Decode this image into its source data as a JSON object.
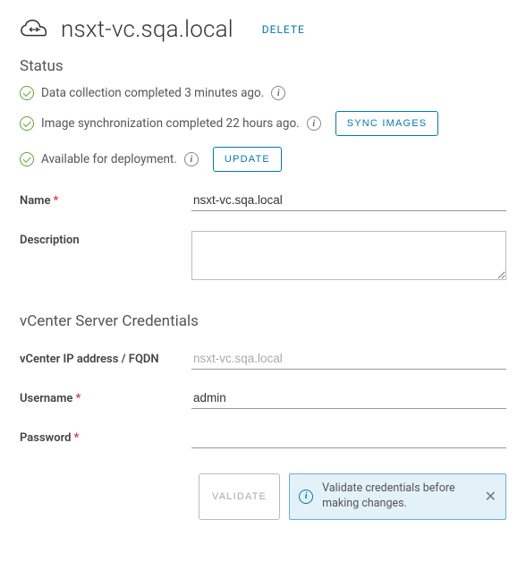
{
  "header": {
    "title": "nsxt-vc.sqa.local",
    "delete_label": "DELETE"
  },
  "status": {
    "heading": "Status",
    "items": [
      {
        "text": "Data collection completed 3 minutes ago."
      },
      {
        "text": "Image synchronization completed 22 hours ago.",
        "action": "SYNC IMAGES"
      },
      {
        "text": "Available for deployment.",
        "action": "UPDATE"
      }
    ]
  },
  "form": {
    "name_label": "Name",
    "name_value": "nsxt-vc.sqa.local",
    "description_label": "Description",
    "description_value": ""
  },
  "credentials": {
    "heading": "vCenter Server Credentials",
    "ip_label": "vCenter IP address / FQDN",
    "ip_placeholder": "nsxt-vc.sqa.local",
    "ip_value": "",
    "username_label": "Username",
    "username_value": "admin",
    "password_label": "Password",
    "password_value": "",
    "validate_label": "VALIDATE",
    "alert_text": "Validate credentials before making changes."
  }
}
